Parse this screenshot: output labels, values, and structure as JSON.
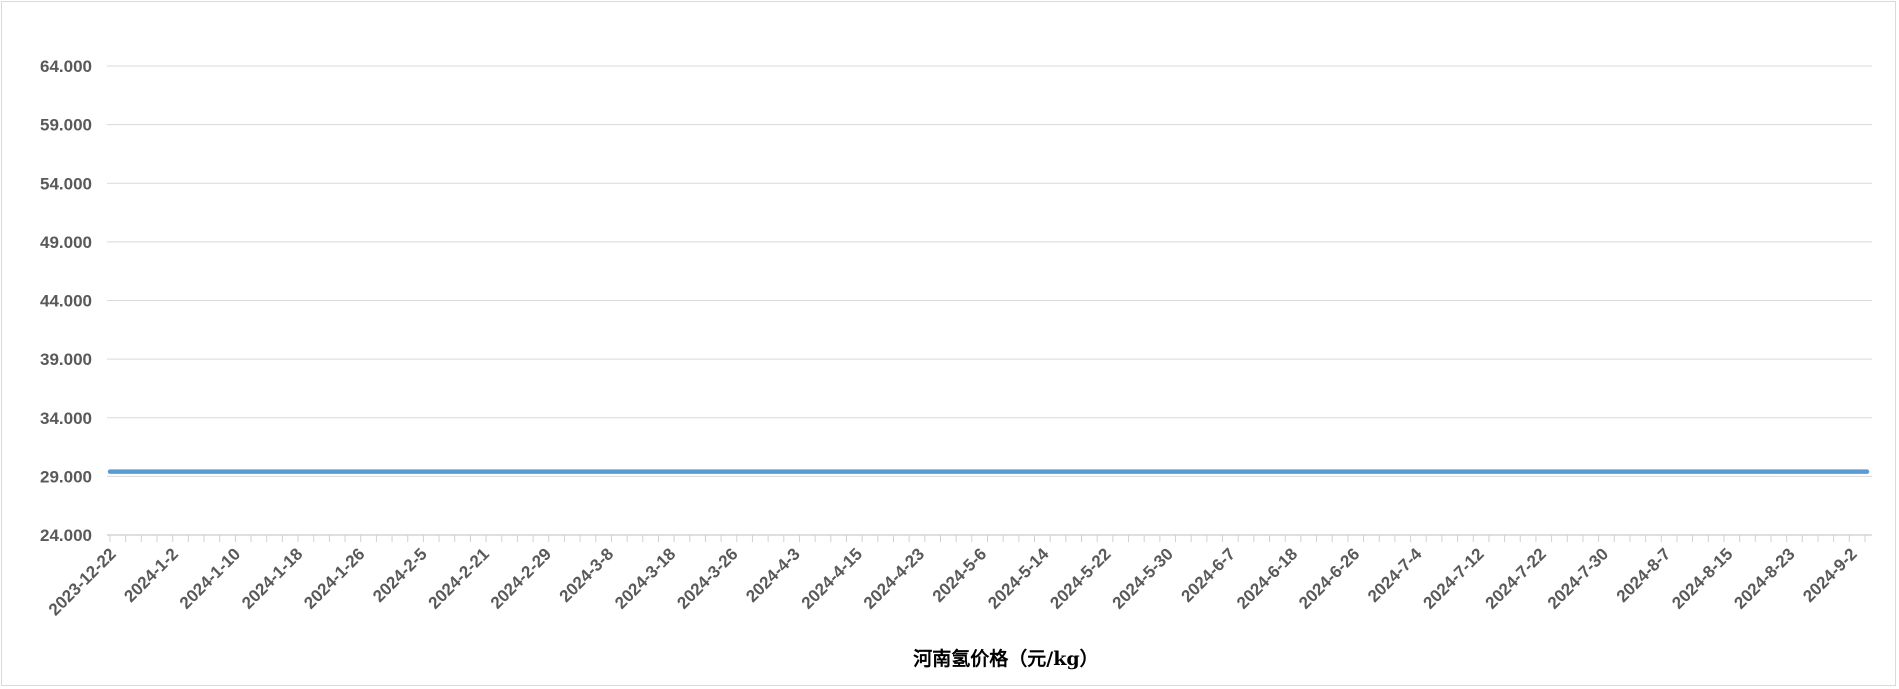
{
  "chart_data": {
    "type": "line",
    "title": "",
    "xlabel": "河南氢价格（元/kg）",
    "ylabel": "",
    "ylim": [
      24,
      64
    ],
    "y_ticks": [
      "24.000",
      "29.000",
      "34.000",
      "39.000",
      "44.000",
      "49.000",
      "54.000",
      "59.000",
      "64.000"
    ],
    "x_tick_labels": [
      "2023-12-22",
      "2024-1-2",
      "2024-1-10",
      "2024-1-18",
      "2024-1-26",
      "2024-2-5",
      "2024-2-21",
      "2024-2-29",
      "2024-3-8",
      "2024-3-18",
      "2024-3-26",
      "2024-4-3",
      "2024-4-15",
      "2024-4-23",
      "2024-5-6",
      "2024-5-14",
      "2024-5-22",
      "2024-5-30",
      "2024-6-7",
      "2024-6-18",
      "2024-6-26",
      "2024-7-4",
      "2024-7-12",
      "2024-7-22",
      "2024-7-30",
      "2024-8-7",
      "2024-8-15",
      "2024-8-23",
      "2024-9-2"
    ],
    "series": [
      {
        "color": "#5b9bd5",
        "x": [
          "2023-12-22",
          "2024-9-2"
        ],
        "values": [
          29.4,
          29.4
        ]
      }
    ],
    "grid": true,
    "legend": "none"
  }
}
